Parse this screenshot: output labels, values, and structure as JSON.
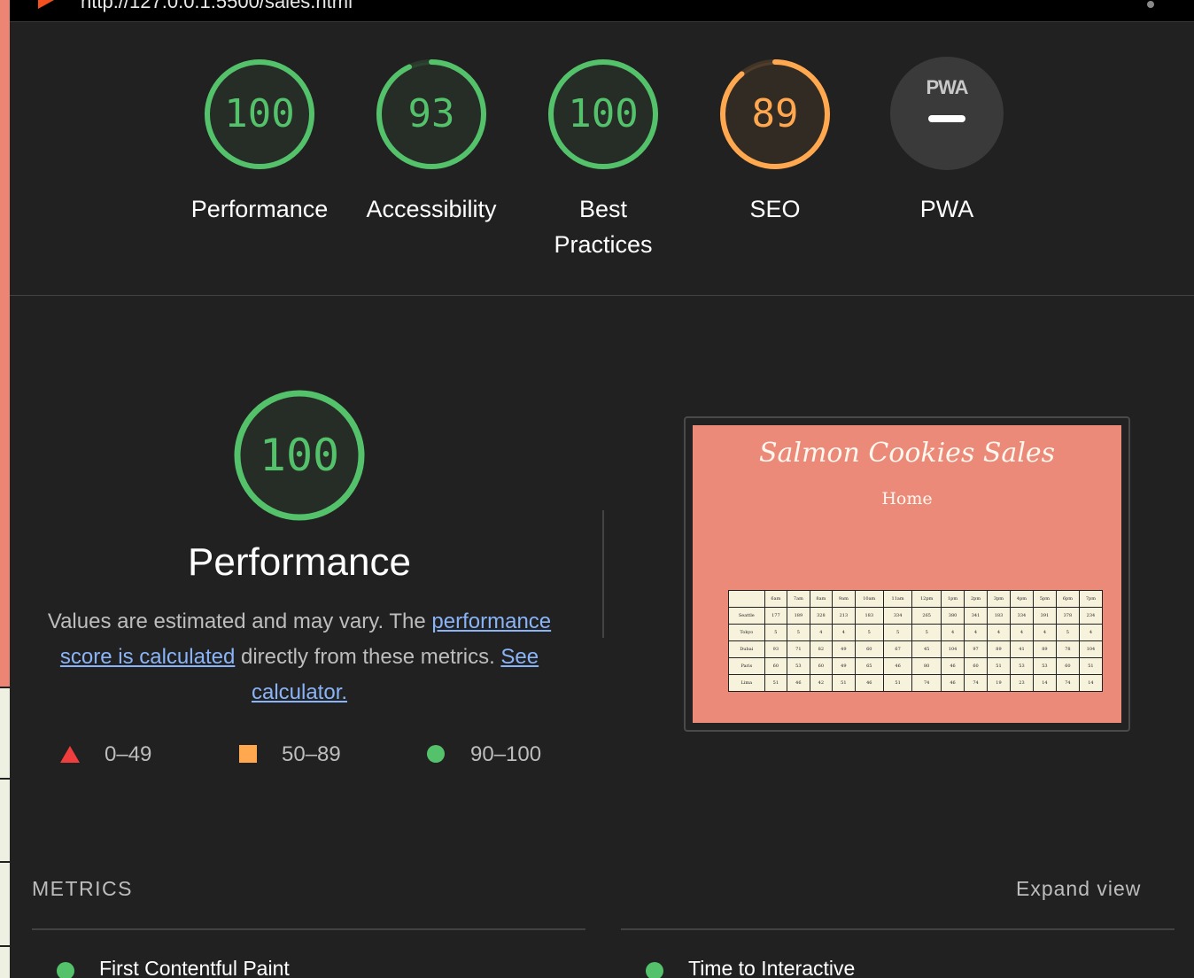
{
  "browser": {
    "url": "http://127.0.0.1:5500/sales.html"
  },
  "colors": {
    "pass": "#54c26b",
    "average": "#ffa84f",
    "fail": "#f03e3e",
    "background": "#212121",
    "link": "#8ab4f8"
  },
  "categories": [
    {
      "label": "Performance",
      "score": "100",
      "percent": 100,
      "status": "pass"
    },
    {
      "label": "Accessibility",
      "score": "93",
      "percent": 93,
      "status": "pass"
    },
    {
      "label": "Best Practices",
      "score": "100",
      "percent": 100,
      "status": "pass"
    },
    {
      "label": "SEO",
      "score": "89",
      "percent": 89,
      "status": "average"
    },
    {
      "label": "PWA",
      "badge_text": "PWA",
      "status": "na"
    }
  ],
  "performance": {
    "score": "100",
    "title": "Performance",
    "desc_prefix": "Values are estimated and may vary. The ",
    "link_score": "performance score is calculated",
    "desc_middle": " directly from these metrics. ",
    "link_calculator": "See calculator."
  },
  "legend": [
    {
      "range": "0–49",
      "icon": "triangle"
    },
    {
      "range": "50–89",
      "icon": "square"
    },
    {
      "range": "90–100",
      "icon": "circle"
    }
  ],
  "screenshot": {
    "title": "Salmon Cookies Sales",
    "nav": "Home",
    "hours": [
      "6am",
      "7am",
      "8am",
      "9am",
      "10am",
      "11am",
      "12pm",
      "1pm",
      "2pm",
      "3pm",
      "4pm",
      "5pm",
      "6pm",
      "7pm"
    ],
    "rows": [
      {
        "city": "Seattle",
        "values": [
          "177",
          "189",
          "328",
          "213",
          "183",
          "334",
          "265",
          "380",
          "341",
          "183",
          "334",
          "391",
          "378",
          "234"
        ]
      },
      {
        "city": "Tokyo",
        "values": [
          "5",
          "5",
          "4",
          "4",
          "5",
          "5",
          "5",
          "4",
          "4",
          "4",
          "4",
          "4",
          "5",
          "4"
        ]
      },
      {
        "city": "Dubai",
        "values": [
          "93",
          "71",
          "82",
          "49",
          "60",
          "67",
          "45",
          "104",
          "97",
          "89",
          "41",
          "89",
          "78",
          "104"
        ]
      },
      {
        "city": "Paris",
        "values": [
          "60",
          "53",
          "60",
          "49",
          "65",
          "46",
          "80",
          "46",
          "60",
          "51",
          "53",
          "53",
          "60",
          "51"
        ]
      },
      {
        "city": "Lima",
        "values": [
          "51",
          "46",
          "42",
          "51",
          "46",
          "51",
          "74",
          "46",
          "74",
          "19",
          "23",
          "14",
          "74",
          "14"
        ]
      }
    ]
  },
  "metrics": {
    "heading": "METRICS",
    "expand": "Expand view",
    "items": [
      {
        "name": "First Contentful Paint",
        "status": "pass"
      },
      {
        "name": "Time to Interactive",
        "status": "pass"
      }
    ]
  }
}
